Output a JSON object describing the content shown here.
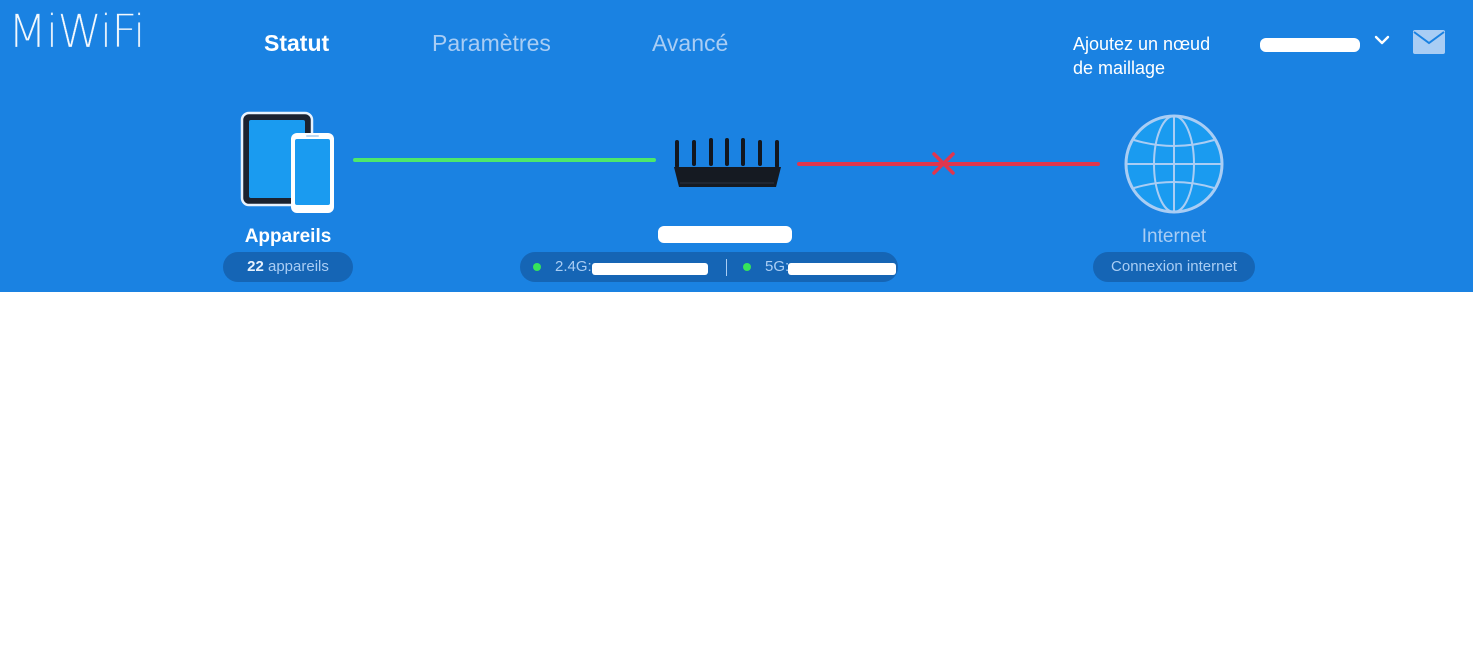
{
  "app": {
    "logo": "MiWiFi"
  },
  "nav": {
    "tabs": [
      {
        "label": "Statut",
        "active": true
      },
      {
        "label": "Paramètres",
        "active": false
      },
      {
        "label": "Avancé",
        "active": false
      }
    ]
  },
  "header": {
    "mesh_link_line1": "Ajoutez un nœud",
    "mesh_link_line2": "de maillage",
    "user_icon": "chevron-down-icon",
    "mail_icon": "mail-icon"
  },
  "topology": {
    "devices": {
      "label": "Appareils",
      "count": "22",
      "count_suffix": "appareils",
      "icon": "devices-icon"
    },
    "router": {
      "icon": "router-icon",
      "band_24_prefix": "2.4G:",
      "band_5_prefix": "5G:"
    },
    "internet": {
      "label": "Internet",
      "status_pill": "Connexion internet",
      "icon": "globe-icon"
    },
    "link_devices_router_status": "connected",
    "link_router_internet_status": "disconnected"
  },
  "colors": {
    "header_bg": "#1a82e2",
    "link_ok": "#4de86b",
    "link_error": "#e0364e",
    "inactive_text": "#a9cdf4"
  }
}
